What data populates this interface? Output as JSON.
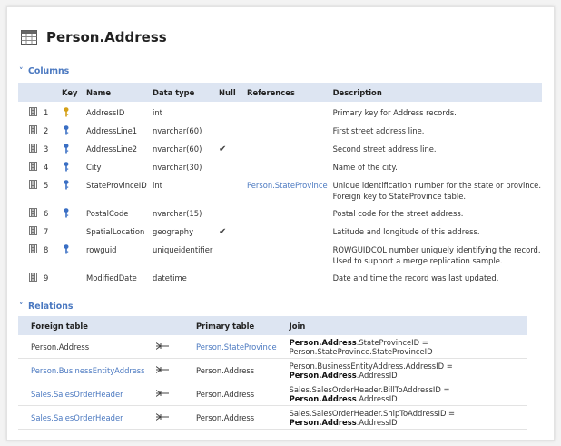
{
  "header": {
    "title": "Person.Address",
    "icon": "table-icon"
  },
  "columns_section": {
    "label": "Columns",
    "headers": [
      "Key",
      "Name",
      "Data type",
      "Null",
      "References",
      "Description"
    ],
    "rows": [
      {
        "num": "1",
        "key": "primary",
        "name": "AddressID",
        "type": "int",
        "null": false,
        "ref": "",
        "desc": "Primary key for Address records."
      },
      {
        "num": "2",
        "key": "index",
        "name": "AddressLine1",
        "type": "nvarchar(60)",
        "null": false,
        "ref": "",
        "desc": "First street address line."
      },
      {
        "num": "3",
        "key": "index",
        "name": "AddressLine2",
        "type": "nvarchar(60)",
        "null": true,
        "ref": "",
        "desc": "Second street address line."
      },
      {
        "num": "4",
        "key": "index",
        "name": "City",
        "type": "nvarchar(30)",
        "null": false,
        "ref": "",
        "desc": "Name of the city."
      },
      {
        "num": "5",
        "key": "index",
        "name": "StateProvinceID",
        "type": "int",
        "null": false,
        "ref": "Person.StateProvince",
        "desc": "Unique identification number for the state or province. Foreign key to StateProvince table."
      },
      {
        "num": "6",
        "key": "index",
        "name": "PostalCode",
        "type": "nvarchar(15)",
        "null": false,
        "ref": "",
        "desc": "Postal code for the street address."
      },
      {
        "num": "7",
        "key": "",
        "name": "SpatialLocation",
        "type": "geography",
        "null": true,
        "ref": "",
        "desc": "Latitude and longitude of this address."
      },
      {
        "num": "8",
        "key": "index",
        "name": "rowguid",
        "type": "uniqueidentifier",
        "null": false,
        "ref": "",
        "desc": "ROWGUIDCOL number uniquely identifying the record. Used to support a merge replication sample."
      },
      {
        "num": "9",
        "key": "",
        "name": "ModifiedDate",
        "type": "datetime",
        "null": false,
        "ref": "",
        "desc": "Date and time the record was last updated."
      }
    ]
  },
  "relations_section": {
    "label": "Relations",
    "headers": [
      "Foreign table",
      "Primary table",
      "Join"
    ],
    "rows": [
      {
        "foreign": "Person.Address",
        "foreign_link": false,
        "primary": "Person.StateProvince",
        "primary_link": true,
        "join": [
          {
            "t": "Person.Address",
            "b": true
          },
          {
            "t": ".StateProvinceID = Person.StateProvince.StateProvinceID",
            "b": false
          }
        ]
      },
      {
        "foreign": "Person.BusinessEntityAddress",
        "foreign_link": true,
        "primary": "Person.Address",
        "primary_link": false,
        "join": [
          {
            "t": "Person.BusinessEntityAddress.AddressID = ",
            "b": false
          },
          {
            "t": "Person.Address",
            "b": true
          },
          {
            "t": ".AddressID",
            "b": false
          }
        ]
      },
      {
        "foreign": "Sales.SalesOrderHeader",
        "foreign_link": true,
        "primary": "Person.Address",
        "primary_link": false,
        "join": [
          {
            "t": "Sales.SalesOrderHeader.BillToAddressID = ",
            "b": false
          },
          {
            "t": "Person.Address",
            "b": true
          },
          {
            "t": ".AddressID",
            "b": false
          }
        ]
      },
      {
        "foreign": "Sales.SalesOrderHeader",
        "foreign_link": true,
        "primary": "Person.Address",
        "primary_link": false,
        "join": [
          {
            "t": "Sales.SalesOrderHeader.ShipToAddressID = ",
            "b": false
          },
          {
            "t": "Person.Address",
            "b": true
          },
          {
            "t": ".AddressID",
            "b": false
          }
        ]
      }
    ]
  },
  "colors": {
    "link": "#4a78c0",
    "header_bg": "#dde5f2",
    "primary_key": "#d4a017",
    "index_key": "#3a6fc4"
  }
}
